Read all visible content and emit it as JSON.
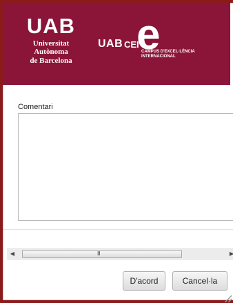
{
  "banner": {
    "uab_logo_mark": "UAB",
    "uab_logo_line1": "Universitat Autònoma",
    "uab_logo_line2": "de Barcelona",
    "cei_logo_uab": "UAB",
    "cei_logo_cei": "CEI",
    "cei_logo_e": "e",
    "cei_logo_sub1": "CAMPUS D'EXCEL·LÈNCIA",
    "cei_logo_sub2": "INTERNACIONAL",
    "background_color": "#8a1538"
  },
  "form": {
    "comment_label": "Comentari",
    "comment_value": ""
  },
  "scrollbar": {
    "left_icon": "arrow-left-icon",
    "right_icon": "arrow-right-icon",
    "thumb_grip": "III"
  },
  "buttons": {
    "ok_label": "D'acord",
    "cancel_label": "Cancel·la"
  }
}
